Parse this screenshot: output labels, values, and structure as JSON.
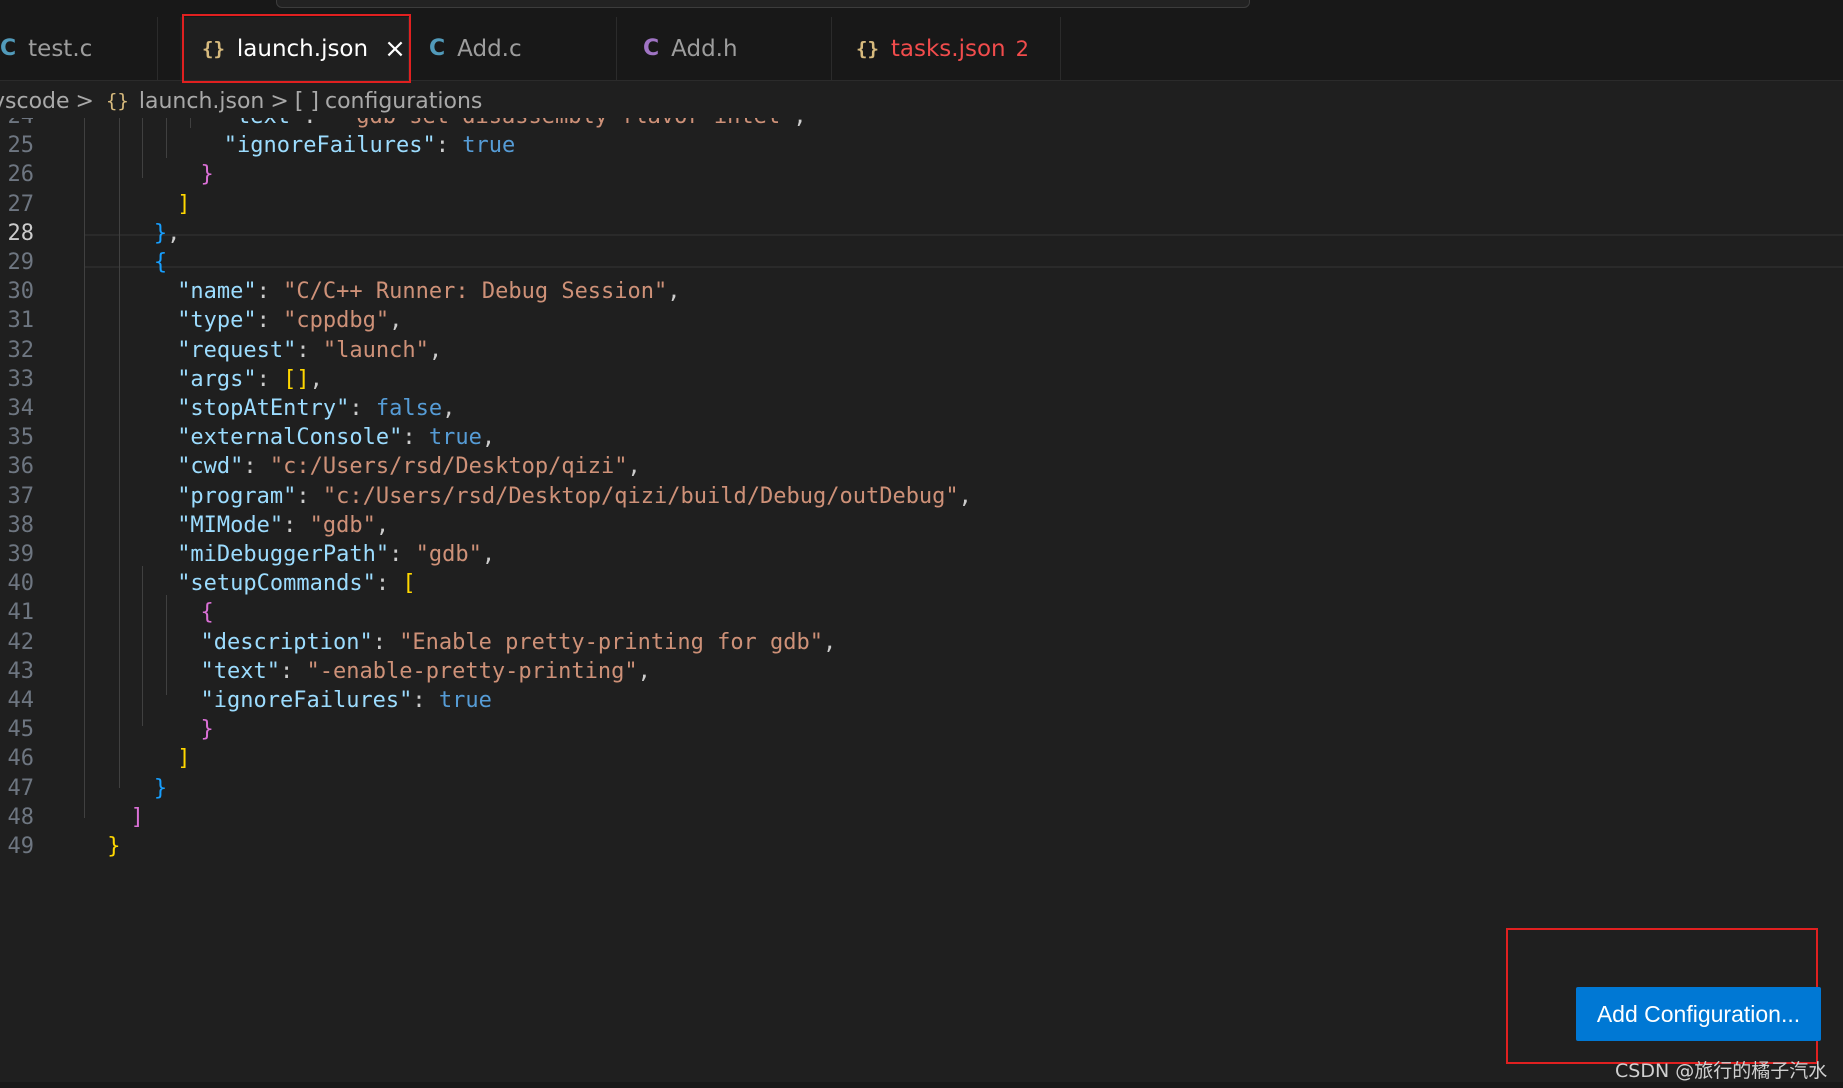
{
  "tabs": [
    {
      "icon": "C",
      "label": "test.c",
      "active": false
    },
    {
      "icon": "{}",
      "label": "launch.json",
      "active": true,
      "close": "×"
    },
    {
      "icon": "C",
      "label": "Add.c",
      "active": false
    },
    {
      "icon": "C",
      "label": "Add.h",
      "active": false
    },
    {
      "icon": "{}",
      "label": "tasks.json",
      "active": false,
      "badge": "2"
    }
  ],
  "breadcrumb": {
    "folder": "vscode",
    "file_icon": "{}",
    "file": "launch.json",
    "section_icon": "[ ]",
    "section": "configurations",
    "separator": ">"
  },
  "editor": {
    "current_line": "28",
    "lines": [
      {
        "n": "24",
        "text": "\"text\": \"-gdb-set disassembly-flavor intel\","
      },
      {
        "n": "25",
        "text": "\"ignoreFailures\": true"
      },
      {
        "n": "26",
        "text": "}"
      },
      {
        "n": "27",
        "text": "]"
      },
      {
        "n": "28",
        "text": "},"
      },
      {
        "n": "29",
        "text": "{"
      },
      {
        "n": "30",
        "text": "\"name\": \"C/C++ Runner: Debug Session\","
      },
      {
        "n": "31",
        "text": "\"type\": \"cppdbg\","
      },
      {
        "n": "32",
        "text": "\"request\": \"launch\","
      },
      {
        "n": "33",
        "text": "\"args\": [],"
      },
      {
        "n": "34",
        "text": "\"stopAtEntry\": false,"
      },
      {
        "n": "35",
        "text": "\"externalConsole\": true,"
      },
      {
        "n": "36",
        "text": "\"cwd\": \"c:/Users/rsd/Desktop/qizi\","
      },
      {
        "n": "37",
        "text": "\"program\": \"c:/Users/rsd/Desktop/qizi/build/Debug/outDebug\","
      },
      {
        "n": "38",
        "text": "\"MIMode\": \"gdb\","
      },
      {
        "n": "39",
        "text": "\"miDebuggerPath\": \"gdb\","
      },
      {
        "n": "40",
        "text": "\"setupCommands\": ["
      },
      {
        "n": "41",
        "text": "{"
      },
      {
        "n": "42",
        "text": "\"description\": \"Enable pretty-printing for gdb\","
      },
      {
        "n": "43",
        "text": "\"text\": \"-enable-pretty-printing\","
      },
      {
        "n": "44",
        "text": "\"ignoreFailures\": true"
      },
      {
        "n": "45",
        "text": "}"
      },
      {
        "n": "46",
        "text": "]"
      },
      {
        "n": "47",
        "text": "}"
      },
      {
        "n": "48",
        "text": "]"
      },
      {
        "n": "49",
        "text": "}"
      }
    ]
  },
  "add_configuration_label": "Add Configuration...",
  "watermark": "CSDN @旅行的橘子汽水",
  "colors": {
    "editor_bg": "#1f1f1f",
    "key": "#9cdcfe",
    "string": "#ce9178",
    "boolean": "#569cd6",
    "button": "#0078d4",
    "annotation": "#e02020"
  }
}
